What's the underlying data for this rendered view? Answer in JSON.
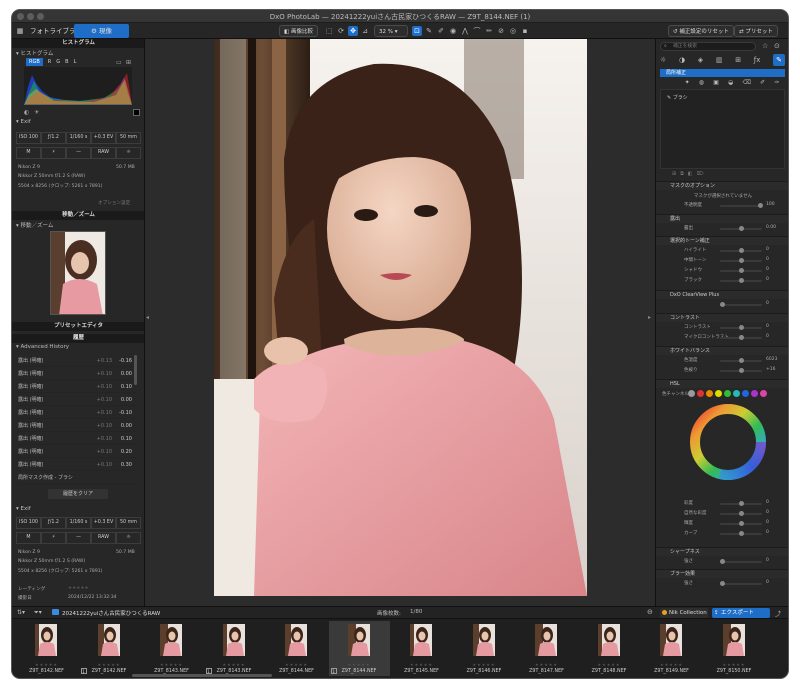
{
  "window": {
    "title": "DxO PhotoLab — 20241222yuiさん古民家ひつくるRAW — Z9T_8144.NEF (1)"
  },
  "toolbar": {
    "tab_library": "フォトライブラリ",
    "tab_customize": "現像",
    "compare_label": "画像比較",
    "zoom": "32 %",
    "reset_label": "補正設定のリセット",
    "preset_label": "プリセット"
  },
  "left": {
    "histogram_title": "ヒストグラム",
    "channels": [
      "RGB",
      "R",
      "G",
      "B",
      "L"
    ],
    "exif_title": "Exif",
    "exif1": [
      "ISO 100",
      "ƒ/1.2",
      "1/160 s",
      "+0.3 EV",
      "50 mm"
    ],
    "exif2": [
      "M",
      "⚡",
      "—",
      "RAW",
      "☼"
    ],
    "camera": "Nikon Z 9",
    "camera_size": "50.7 MB",
    "lens": "Nikkor Z 50mm f/1.2 S (RAW)",
    "dims": "5504 x 8256 (クロップ: 5261 x 7891)",
    "option_label": "オプション設定",
    "move_zoom_title": "移動／ズーム",
    "move_zoom_sub": "移動／ズーム",
    "preset_editor_title": "プリセットエディタ",
    "history_title": "履歴",
    "history_group": "Advanced History",
    "history_items": [
      {
        "label": "露出 (明確)",
        "from": "+0.13",
        "to": "-0.16"
      },
      {
        "label": "露出 (明確)",
        "from": "+0.10",
        "to": "0.00"
      },
      {
        "label": "露出 (明確)",
        "from": "+0.10",
        "to": "0.10"
      },
      {
        "label": "露出 (明確)",
        "from": "+0.10",
        "to": "0.00"
      },
      {
        "label": "露出 (明確)",
        "from": "+0.10",
        "to": "-0.10"
      },
      {
        "label": "露出 (明確)",
        "from": "+0.10",
        "to": "0.00"
      },
      {
        "label": "露出 (明確)",
        "from": "+0.10",
        "to": "0.10"
      },
      {
        "label": "露出 (明確)",
        "from": "+0.10",
        "to": "0.20"
      },
      {
        "label": "露出 (明確)",
        "from": "+0.10",
        "to": "0.30"
      }
    ],
    "history_last": "局所マスク作成 - ブラシ",
    "history_clear": "履歴をクリア",
    "exif_title2": "Exif",
    "rating_label": "レーティング",
    "date_label": "撮影日",
    "date_value": "2024/12/22 13:32:34"
  },
  "right": {
    "search_placeholder": "補正を検索",
    "local_title": "局所補正",
    "brush_label": "ブラシ",
    "mask_options": "マスクのオプション",
    "mask_none": "マスクが選択されていません",
    "opacity": "不透明度",
    "opacity_value": "100",
    "exposure_sec": "露出",
    "exposure": "露出",
    "exposure_value": "0.00",
    "tone_sec": "選択的トーン補正",
    "tone_rows": [
      "ハイライト",
      "中間トーン",
      "シャドウ",
      "ブラック"
    ],
    "tone_values": [
      "0",
      "0",
      "0",
      "0"
    ],
    "dxo_sec": "DxO ClearView Plus",
    "dxo_value": "0",
    "micro_sec": "コントラスト",
    "micro_rows": [
      "コントラスト",
      "マイクロコントラスト"
    ],
    "micro_values": [
      "0",
      "0"
    ],
    "wb_sec": "ホワイトバランス",
    "wb_rows": [
      "色温度",
      "色被り"
    ],
    "wb_values": [
      "6023",
      "+16"
    ],
    "hsl_sec": "HSL",
    "hsl_channel": "色チャンネル",
    "hsl_rows": [
      "彩度",
      "自然な彩度",
      "輝度",
      "カーブ"
    ],
    "hsl_values": [
      "0",
      "0",
      "0",
      "0"
    ],
    "sharp_sec": "シャープネス",
    "sharp_row": "強さ",
    "sharp_value": "0",
    "blur_sec": "ブラー効果",
    "blur_row": "強さ",
    "blur_value": "0",
    "swatch_colors": [
      "#9a9a9a",
      "#d33",
      "#e80",
      "#dd0",
      "#3b3",
      "#2bb",
      "#26d",
      "#a3c",
      "#d4a"
    ]
  },
  "filmstrip": {
    "folder": "20241222yuiさん古民家ひつくるRAW",
    "count_label": "画像枚数:",
    "count_value": "1/80",
    "nik_label": "Nik Collection",
    "export_label": "エクスポート",
    "thumbs": [
      "Z9T_8142.NEF",
      "Z9T_8142.NEF",
      "Z9T_8143.NEF",
      "Z9T_8143.NEF",
      "Z9T_8144.NEF",
      "Z9T_8144.NEF",
      "Z9T_8145.NEF",
      "Z9T_8146.NEF",
      "Z9T_8147.NEF",
      "Z9T_8148.NEF",
      "Z9T_8149.NEF",
      "Z9T_8150.NEF"
    ],
    "badges": [
      "",
      "1",
      "",
      "1",
      "",
      "1",
      "",
      "",
      "",
      "",
      "",
      ""
    ],
    "stars": "★★★★★"
  },
  "colors": {
    "accent": "#1e6ec8",
    "panel_bg": "#272727",
    "header_bg": "#1a1a1a"
  }
}
